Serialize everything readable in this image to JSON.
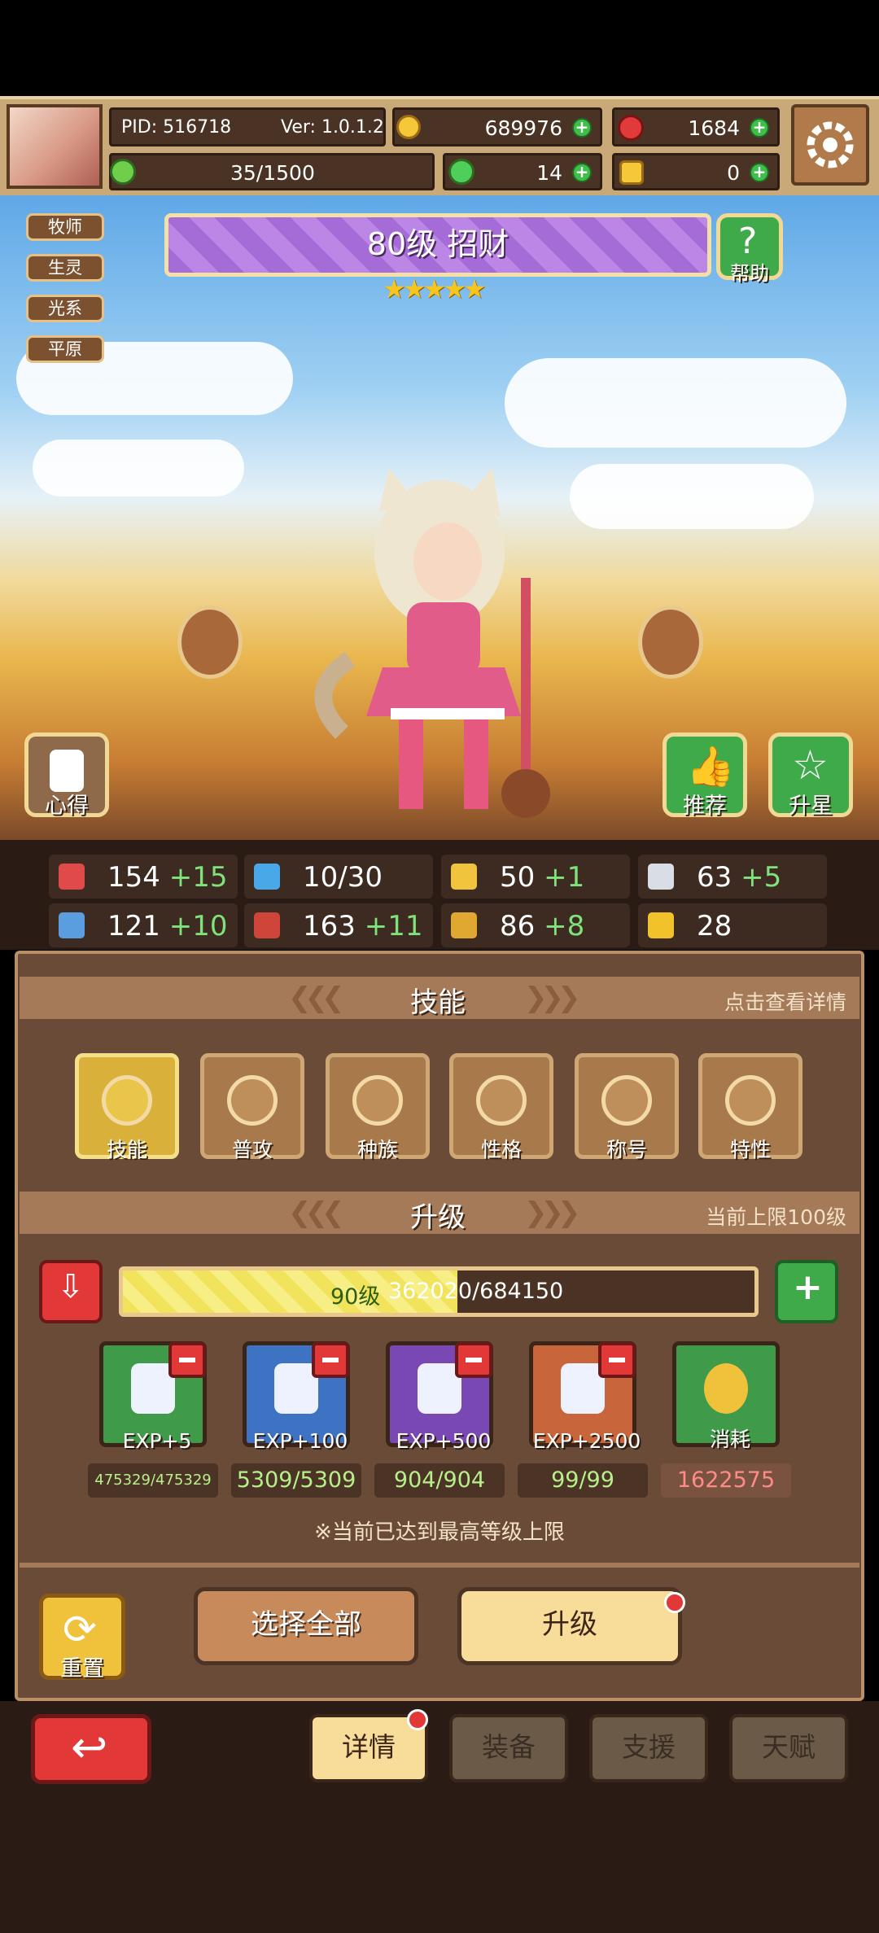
{
  "topbar": {
    "pid": "PID: 516718",
    "version": "Ver: 1.0.1.2",
    "gold": "689976",
    "gems": "1684",
    "stamina": "35/1500",
    "clover": "14",
    "key": "0"
  },
  "tags": [
    "牧师",
    "生灵",
    "光系",
    "平原"
  ],
  "hero": {
    "banner": "80级 招财",
    "stars": "★★★★★",
    "star_count": 5
  },
  "buttons": {
    "help": "帮助",
    "insight": "心得",
    "recommend": "推荐",
    "star_up": "升星"
  },
  "stats": [
    {
      "icon": "heart-icon",
      "value": "154",
      "bonus": "+15",
      "color": "#e04a4a"
    },
    {
      "icon": "mana-drop-icon",
      "value": "10/30",
      "bonus": "",
      "color": "#49a8e8"
    },
    {
      "icon": "shield-icon",
      "value": "50",
      "bonus": "+1",
      "color": "#f0c43c"
    },
    {
      "icon": "boot-icon",
      "value": "63",
      "bonus": "+5",
      "color": "#d8dde6"
    },
    {
      "icon": "fist-icon",
      "value": "121",
      "bonus": "+10",
      "color": "#5b9ee0"
    },
    {
      "icon": "book-icon",
      "value": "163",
      "bonus": "+11",
      "color": "#d0453a"
    },
    {
      "icon": "flag-icon",
      "value": "86",
      "bonus": "+8",
      "color": "#e0a830"
    },
    {
      "icon": "crown-icon",
      "value": "28",
      "bonus": "",
      "color": "#f2c22a"
    }
  ],
  "skills_section": {
    "title": "技能",
    "hint": "点击查看详情",
    "items": [
      "技能",
      "普攻",
      "种族",
      "性格",
      "称号",
      "特性"
    ]
  },
  "level_section": {
    "title": "升级",
    "hint": "当前上限100级",
    "bar_level": "90级",
    "bar_exp": "362020/684150",
    "bar_progress": 0.529
  },
  "items": [
    {
      "label": "EXP+5",
      "count": "475329/475329",
      "color": "#3f9a4a"
    },
    {
      "label": "EXP+100",
      "count": "5309/5309",
      "color": "#3d73c2"
    },
    {
      "label": "EXP+500",
      "count": "904/904",
      "color": "#7a48b4"
    },
    {
      "label": "EXP+2500",
      "count": "99/99",
      "color": "#c9653a"
    },
    {
      "label": "消耗",
      "count": "1622575",
      "color": "#3f9a4a"
    }
  ],
  "max_notice": "※当前已达到最高等级上限",
  "actions": {
    "reset": "重置",
    "select_all": "选择全部",
    "upgrade": "升级"
  },
  "tabs": [
    "详情",
    "装备",
    "支援",
    "天赋"
  ]
}
